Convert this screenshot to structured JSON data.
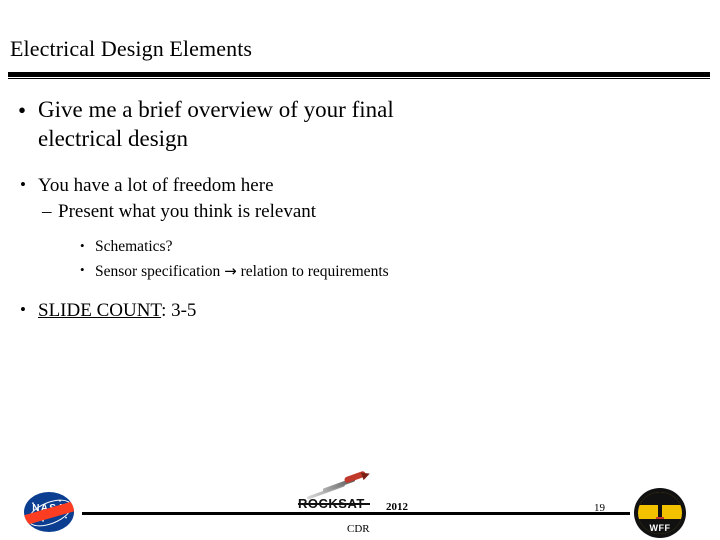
{
  "slide": {
    "title": "Electrical Design Elements",
    "bullets": {
      "b1_marker": "•",
      "b1_line1": "Give me a brief overview of your final",
      "b1_line2": "electrical design",
      "b2_marker": "•",
      "b2_text": "You have a lot of freedom here",
      "b3_marker": "–",
      "b3_text": "Present what you think is relevant",
      "b4_marker": "•",
      "b4_text": "Schematics?",
      "b5_marker": "•",
      "b5_text_before": "Sensor specification",
      "b5_arrow": "→",
      "b5_text_after": "relation to requirements",
      "b6_marker": "•",
      "b6_underlined": "SLIDE COUNT",
      "b6_rest": ": 3-5"
    }
  },
  "footer": {
    "date": "2012",
    "review": "CDR",
    "page_number": "19",
    "nasa_wordmark": "NASA",
    "rocksat_wordmark": "ROCKSAT",
    "wff_label": "WFF"
  }
}
